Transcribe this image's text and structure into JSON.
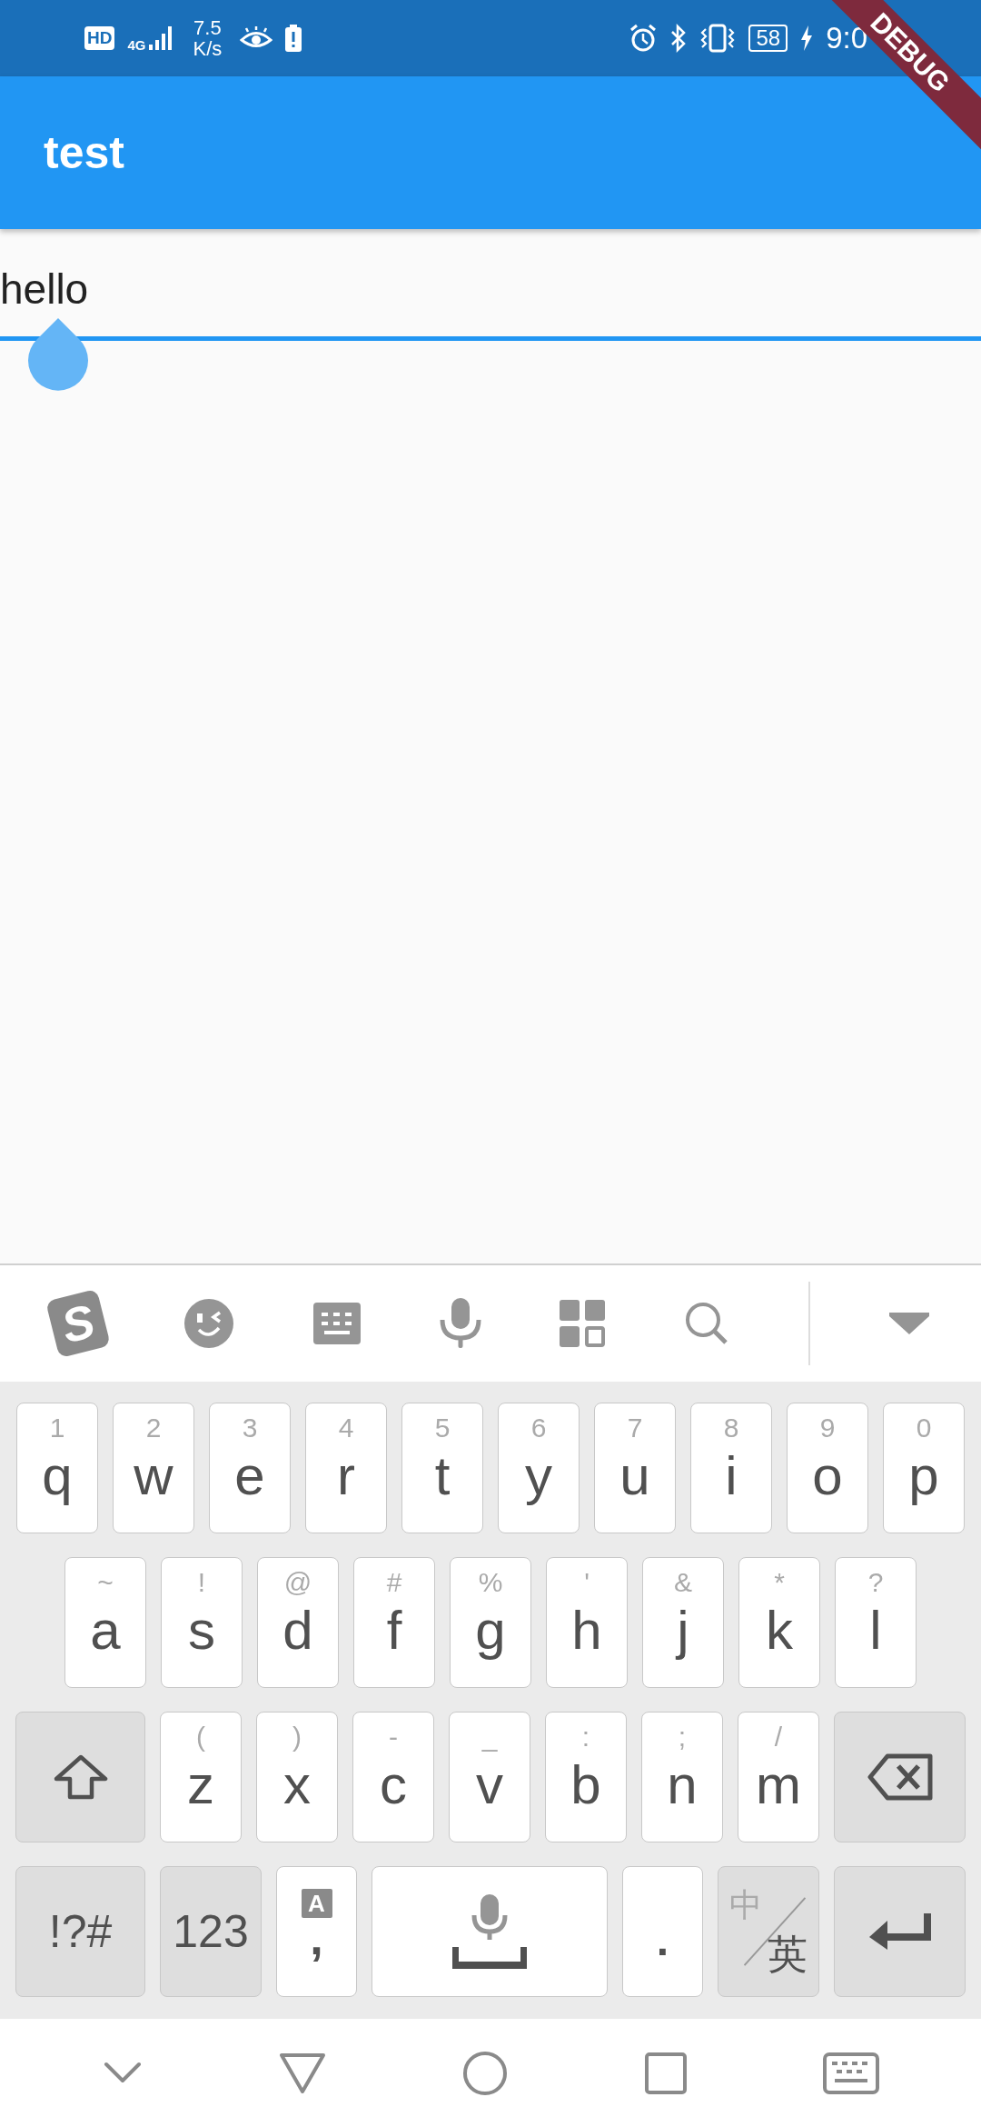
{
  "status_bar": {
    "hd_badge": "HD",
    "network_type": "4G",
    "speed_value": "7.5",
    "speed_unit": "K/s",
    "battery": "58",
    "time": "9:0"
  },
  "debug_banner": "DEBUG",
  "app_bar": {
    "title": "test"
  },
  "text_field": {
    "value": "hello"
  },
  "keyboard_toolbar": {
    "logo": "S"
  },
  "keyboard": {
    "rows": [
      {
        "keys": [
          {
            "kind": "letter",
            "label": "q",
            "hint": "1"
          },
          {
            "kind": "letter",
            "label": "w",
            "hint": "2"
          },
          {
            "kind": "letter",
            "label": "e",
            "hint": "3"
          },
          {
            "kind": "letter",
            "label": "r",
            "hint": "4"
          },
          {
            "kind": "letter",
            "label": "t",
            "hint": "5"
          },
          {
            "kind": "letter",
            "label": "y",
            "hint": "6"
          },
          {
            "kind": "letter",
            "label": "u",
            "hint": "7"
          },
          {
            "kind": "letter",
            "label": "i",
            "hint": "8"
          },
          {
            "kind": "letter",
            "label": "o",
            "hint": "9"
          },
          {
            "kind": "letter",
            "label": "p",
            "hint": "0"
          }
        ]
      },
      {
        "keys": [
          {
            "kind": "letter",
            "label": "a",
            "hint": "~"
          },
          {
            "kind": "letter",
            "label": "s",
            "hint": "!"
          },
          {
            "kind": "letter",
            "label": "d",
            "hint": "@"
          },
          {
            "kind": "letter",
            "label": "f",
            "hint": "#"
          },
          {
            "kind": "letter",
            "label": "g",
            "hint": "%"
          },
          {
            "kind": "letter",
            "label": "h",
            "hint": "'"
          },
          {
            "kind": "letter",
            "label": "j",
            "hint": "&"
          },
          {
            "kind": "letter",
            "label": "k",
            "hint": "*"
          },
          {
            "kind": "letter",
            "label": "l",
            "hint": "?"
          }
        ]
      },
      {
        "keys": [
          {
            "kind": "shift"
          },
          {
            "kind": "letter",
            "label": "z",
            "hint": "("
          },
          {
            "kind": "letter",
            "label": "x",
            "hint": ")"
          },
          {
            "kind": "letter",
            "label": "c",
            "hint": "-"
          },
          {
            "kind": "letter",
            "label": "v",
            "hint": "_"
          },
          {
            "kind": "letter",
            "label": "b",
            "hint": ":"
          },
          {
            "kind": "letter",
            "label": "n",
            "hint": ";"
          },
          {
            "kind": "letter",
            "label": "m",
            "hint": "/"
          },
          {
            "kind": "backspace"
          }
        ]
      },
      {
        "keys": [
          {
            "kind": "symbols",
            "label": "!?#"
          },
          {
            "kind": "numbers",
            "label": "123"
          },
          {
            "kind": "comma",
            "label": ",",
            "badge": "A"
          },
          {
            "kind": "space"
          },
          {
            "kind": "period",
            "label": "."
          },
          {
            "kind": "language",
            "top": "中",
            "bottom": "英"
          },
          {
            "kind": "enter"
          }
        ]
      }
    ]
  }
}
